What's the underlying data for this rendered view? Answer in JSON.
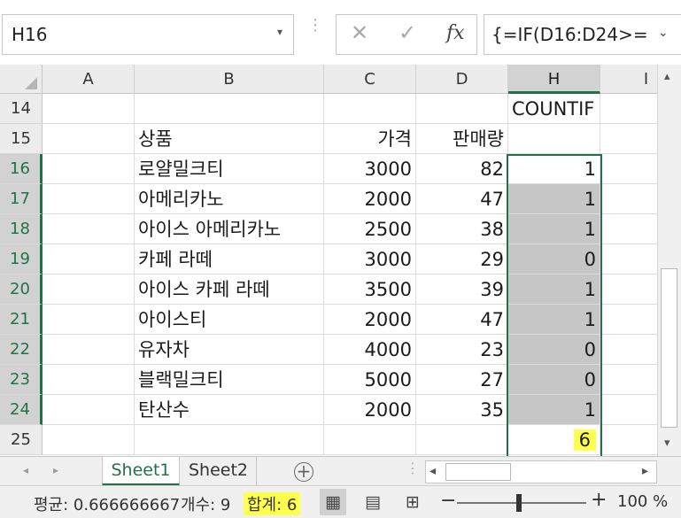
{
  "formula_bar": {
    "name_box": "H16",
    "name_box_arrow": "▾",
    "cancel_icon": "✕",
    "enter_icon": "✓",
    "fx_icon": "fx",
    "formula": "{=IF(D16:D24>=",
    "formula_arrow": "⌄"
  },
  "columns": [
    "A",
    "B",
    "C",
    "D",
    "H",
    "I"
  ],
  "rows": [
    {
      "num": "14",
      "b": "",
      "c": "",
      "d": "",
      "h": "COUNTIF"
    },
    {
      "num": "15",
      "b": "상품",
      "c": "가격",
      "d": "판매량",
      "h": ""
    },
    {
      "num": "16",
      "b": "로얄밀크티",
      "c": "3000",
      "d": "82",
      "h": "1"
    },
    {
      "num": "17",
      "b": "아메리카노",
      "c": "2000",
      "d": "47",
      "h": "1"
    },
    {
      "num": "18",
      "b": "아이스 아메리카노",
      "c": "2500",
      "d": "38",
      "h": "1"
    },
    {
      "num": "19",
      "b": "카페 라떼",
      "c": "3000",
      "d": "29",
      "h": "0"
    },
    {
      "num": "20",
      "b": "아이스 카페 라떼",
      "c": "3500",
      "d": "39",
      "h": "1"
    },
    {
      "num": "21",
      "b": "아이스티",
      "c": "2000",
      "d": "47",
      "h": "1"
    },
    {
      "num": "22",
      "b": "유자차",
      "c": "4000",
      "d": "23",
      "h": "0"
    },
    {
      "num": "23",
      "b": "블랙밀크티",
      "c": "5000",
      "d": "27",
      "h": "0"
    },
    {
      "num": "24",
      "b": "탄산수",
      "c": "2000",
      "d": "35",
      "h": "1"
    },
    {
      "num": "25",
      "b": "",
      "c": "",
      "d": "",
      "h": "6"
    }
  ],
  "sheet_tabs": {
    "prev_icon": "◂",
    "next_icon": "▸",
    "tabs": [
      "Sheet1",
      "Sheet2"
    ],
    "active": "Sheet1",
    "add_icon": "+"
  },
  "hscroll": {
    "left_icon": "◂",
    "right_icon": "▸"
  },
  "vscroll": {
    "up_icon": "▴",
    "down_icon": "▾"
  },
  "status_bar": {
    "average": "평균: 0.666666667",
    "count": "개수: 9",
    "sum": "합계: 6",
    "view_normal_icon": "▦",
    "view_page_layout_icon": "▤",
    "view_page_break_icon": "⊞",
    "zoom_minus": "−",
    "zoom_plus": "+",
    "zoom": "100 %"
  },
  "colors": {
    "accent": "#217346",
    "selection": "#c6c6c6",
    "highlight": "#ffff4d"
  }
}
